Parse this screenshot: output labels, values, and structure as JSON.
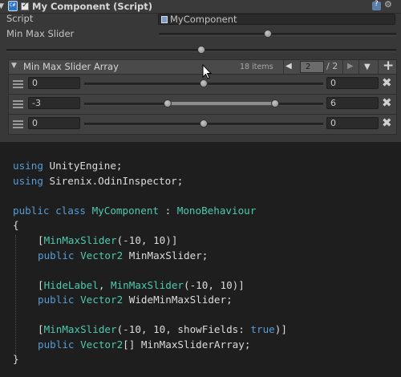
{
  "inspector": {
    "component_title": "My Component (Script)",
    "script_label": "Script",
    "script_value": "MyComponent",
    "min_max_slider_label": "Min Max Slider",
    "list": {
      "title": "Min Max Slider Array",
      "item_count": "18 items",
      "page_current": "2",
      "page_total": "/ 2",
      "rows": [
        {
          "min": "0",
          "max": "0"
        },
        {
          "min": "-3",
          "max": "6"
        },
        {
          "min": "0",
          "max": "0"
        }
      ]
    }
  },
  "code": {
    "l1_kw": "using",
    "l1_rest": " UnityEngine;",
    "l2_kw": "using",
    "l2_rest": " Sirenix.OdinInspector;",
    "l3_kw": "public class",
    "l3_sp": " ",
    "l3_name": "MyComponent",
    "l3_colon": " : ",
    "l3_base": "MonoBehaviour",
    "open_brace": "{",
    "l5_open": "[",
    "l5_attr": "MinMaxSlider",
    "l5_args": "(-10, 10)]",
    "l6_kw": "public",
    "l6_type": "Vector2",
    "l6_name": " MinMaxSlider;",
    "l8_open": "[",
    "l8_attr1": "HideLabel",
    "l8_comma": ", ",
    "l8_attr2": "MinMaxSlider",
    "l8_args": "(-10, 10)]",
    "l9_kw": "public",
    "l9_type": "Vector2",
    "l9_name": " WideMinMaxSlider;",
    "l11_open": "[",
    "l11_attr": "MinMaxSlider",
    "l11_args": "(-10, 10, showFields: ",
    "l11_true": "true",
    "l11_close": ")]",
    "l12_kw": "public",
    "l12_type": "Vector2",
    "l12_name": "[] MinMaxSliderArray;",
    "close_brace": "}"
  },
  "colors": {
    "keyword": "#569cd6",
    "type": "#4ec9b0",
    "inspector_bg": "#383838",
    "code_bg": "#1e1e1e"
  },
  "icons": [
    "script-icon",
    "checkbox-icon",
    "help-icon",
    "settings-icon",
    "drag-handle-icon",
    "remove-icon",
    "add-icon",
    "prev-page-icon",
    "next-page-icon",
    "menu-icon",
    "mouse-cursor-icon"
  ]
}
